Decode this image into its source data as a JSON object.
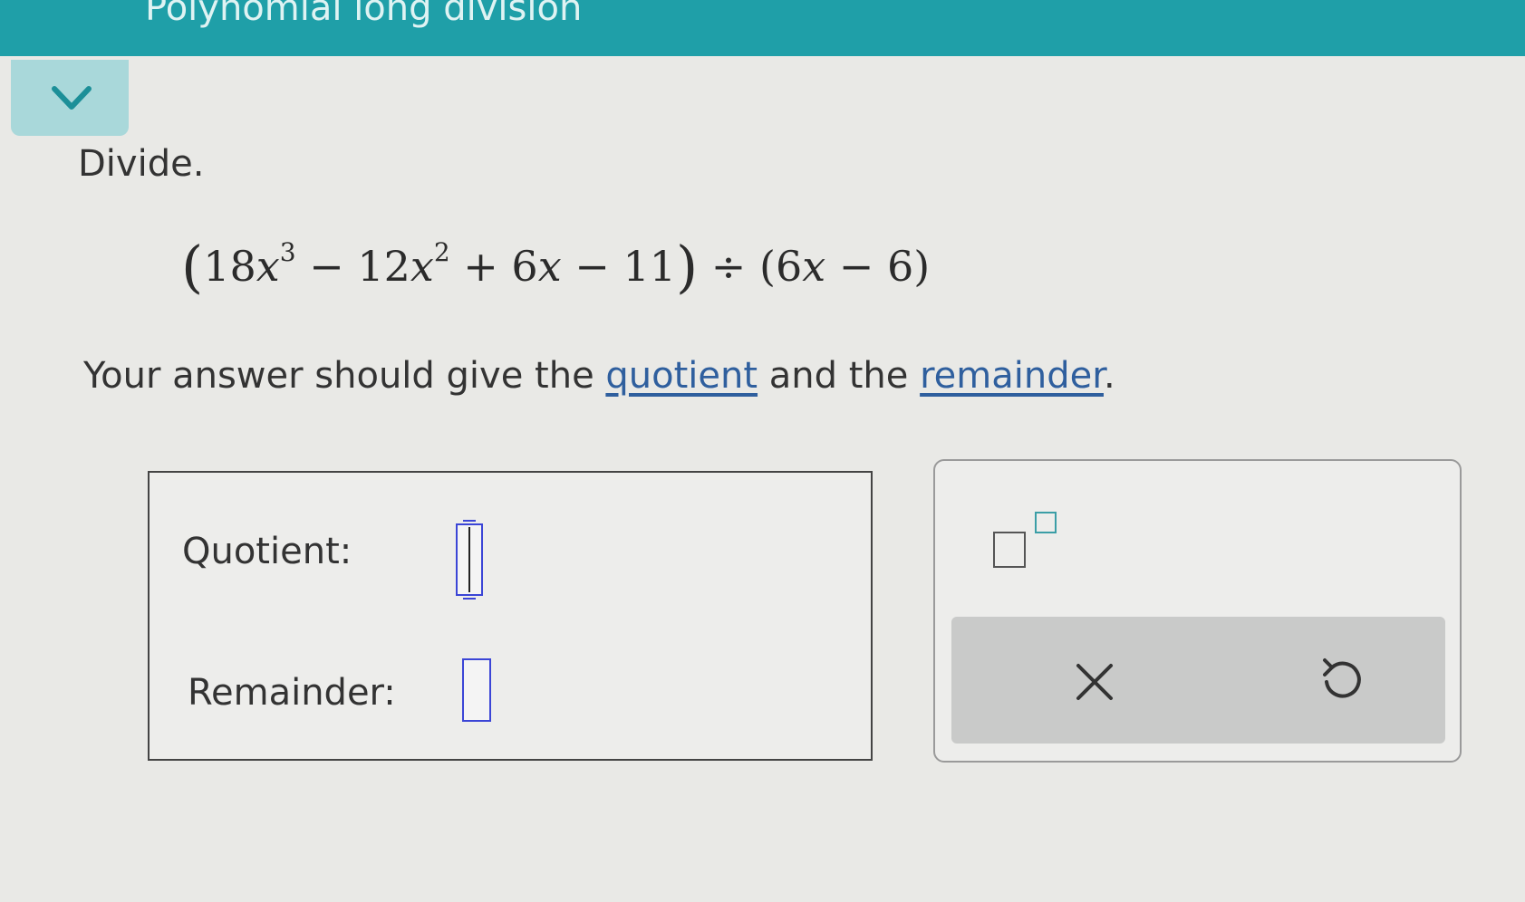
{
  "header": {
    "title": "Polynomial long division"
  },
  "question": {
    "instruction": "Divide.",
    "expression": {
      "open_paren": "(",
      "c1": "18",
      "v1": "x",
      "e1": "3",
      "op1": " − 12",
      "v2": "x",
      "e2": "2",
      "op2": " + 6",
      "v3": "x",
      "op3": " − 11",
      "close_paren": ")",
      "divide": " ÷ ",
      "divisor_open": "(",
      "divisor_c": "6",
      "divisor_v": "x",
      "divisor_rest": " − 6",
      "divisor_close": ")"
    },
    "prompt": {
      "before": "Your answer should give the ",
      "link1": "quotient",
      "middle": " and the ",
      "link2": "remainder",
      "after": "."
    }
  },
  "answer": {
    "quotient_label": "Quotient:",
    "remainder_label": "Remainder:",
    "quotient_value": "",
    "remainder_value": ""
  },
  "toolbox": {
    "superscript_icon": "superscript-icon",
    "clear_icon": "x-icon",
    "undo_icon": "undo-icon"
  },
  "colors": {
    "header": "#1f9fa8",
    "link": "#2f5f9e",
    "field_border": "#3b45d6"
  }
}
